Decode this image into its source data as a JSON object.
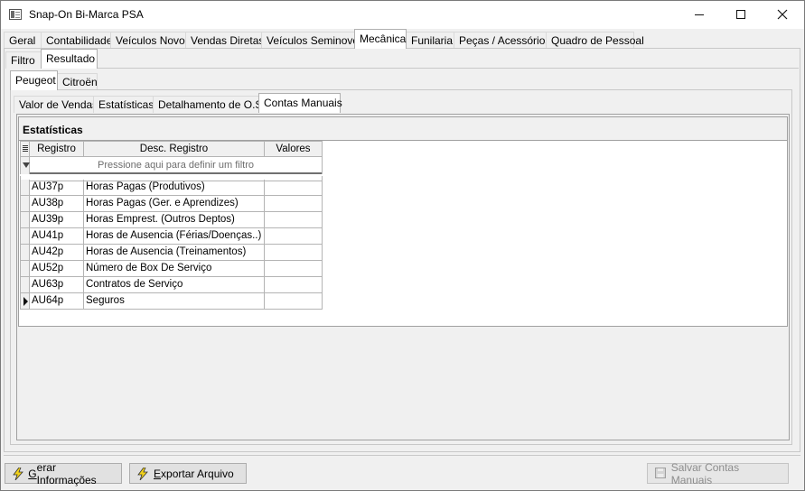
{
  "window": {
    "title": "Snap-On Bi-Marca PSA"
  },
  "main_tabs": [
    {
      "label": "Geral"
    },
    {
      "label": "Contabilidade"
    },
    {
      "label": "Veículos Novos"
    },
    {
      "label": "Vendas Diretas"
    },
    {
      "label": "Veículos Seminovos"
    },
    {
      "label": "Mecânica"
    },
    {
      "label": "Funilaria"
    },
    {
      "label": "Peças / Acessórios"
    },
    {
      "label": "Quadro de Pessoal"
    }
  ],
  "view_tabs": [
    {
      "label": "Filtro"
    },
    {
      "label": "Resultado"
    }
  ],
  "brand_tabs": [
    {
      "label": "Peugeot"
    },
    {
      "label": "Citroën"
    }
  ],
  "report_tabs": [
    {
      "label": "Valor de Vendas"
    },
    {
      "label": "Estatísticas"
    },
    {
      "label": "Detalhamento de O.S."
    },
    {
      "label": "Contas Manuais"
    }
  ],
  "group": {
    "title": "Estatísticas"
  },
  "grid": {
    "columns": [
      "Registro",
      "Desc. Registro",
      "Valores"
    ],
    "filter_placeholder": "Pressione aqui para definir um filtro",
    "rows": [
      {
        "registro": "AU37p",
        "desc": "Horas Pagas (Produtivos)",
        "valores": ""
      },
      {
        "registro": "AU38p",
        "desc": "Horas Pagas (Ger. e Aprendizes)",
        "valores": ""
      },
      {
        "registro": "AU39p",
        "desc": "Horas Emprest. (Outros Deptos)",
        "valores": ""
      },
      {
        "registro": "AU41p",
        "desc": "Horas de Ausencia (Férias/Doenças..)",
        "valores": ""
      },
      {
        "registro": "AU42p",
        "desc": "Horas de Ausencia (Treinamentos)",
        "valores": ""
      },
      {
        "registro": "AU52p",
        "desc": "Número de Box De Serviço",
        "valores": ""
      },
      {
        "registro": "AU63p",
        "desc": "Contratos de Serviço",
        "valores": ""
      },
      {
        "registro": "AU64p",
        "desc": "Seguros",
        "valores": ""
      }
    ]
  },
  "buttons": {
    "gerar_prefix": "",
    "gerar_accel": "G",
    "gerar_rest": "erar Informações",
    "exportar_prefix": "",
    "exportar_accel": "E",
    "exportar_rest": "xportar Arquivo",
    "salvar_label": "Salvar Contas Manuais"
  },
  "colors": {
    "accent_bolt": "#e8c300",
    "disabled_text": "#8d8d8d"
  }
}
